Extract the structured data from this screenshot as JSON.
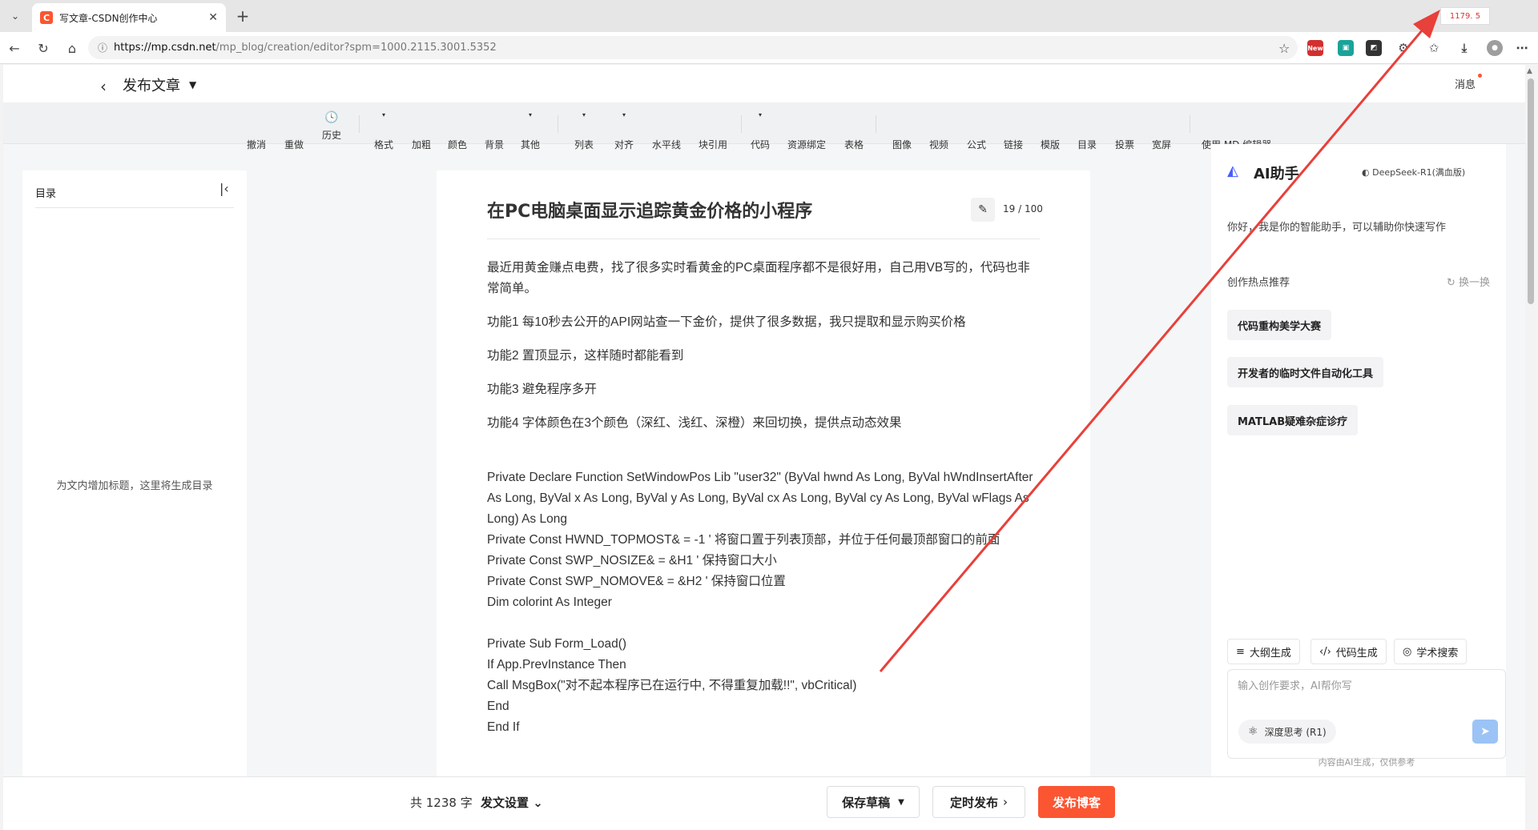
{
  "browser": {
    "tab_title": "写文章-CSDN创作中心",
    "tab_icon_letter": "C",
    "url_host": "https://mp.csdn.net",
    "url_path": "/mp_blog/creation/editor?spm=1000.2115.3001.5352",
    "coord_readout": "1179. 5",
    "ext_new_label": "New"
  },
  "header": {
    "title": "发布文章",
    "messages": "消息"
  },
  "toolbar": {
    "items": [
      "撤消",
      "重做",
      "历史",
      "格式",
      "加粗",
      "颜色",
      "背景",
      "其他",
      "列表",
      "对齐",
      "水平线",
      "块引用",
      "代码",
      "资源绑定",
      "表格",
      "图像",
      "视频",
      "公式",
      "链接",
      "模版",
      "目录",
      "投票",
      "宽屏",
      "使用 MD 编辑器"
    ]
  },
  "toc": {
    "title": "目录",
    "empty_hint": "为文内增加标题，这里将生成目录"
  },
  "editor": {
    "title": "在PC电脑桌面显示追踪黄金价格的小程序",
    "title_count": "19 / 100",
    "paragraphs": [
      "最近用黄金赚点电费，找了很多实时看黄金的PC桌面程序都不是很好用，自己用VB写的，代码也非常简单。",
      "功能1  每10秒去公开的API网站查一下金价，提供了很多数据，我只提取和显示购买价格",
      "功能2  置顶显示，这样随时都能看到",
      "功能3  避免程序多开",
      "功能4  字体颜色在3个颜色（深红、浅红、深橙）来回切换，提供点动态效果"
    ],
    "code1": [
      "Private Declare Function SetWindowPos Lib \"user32\" (ByVal hwnd As Long, ByVal hWndInsertAfter As Long, ByVal x As Long, ByVal y As Long, ByVal cx As Long, ByVal cy As Long, ByVal wFlags As Long) As Long",
      "Private Const HWND_TOPMOST& = -1 ' 将窗口置于列表顶部，并位于任何最顶部窗口的前面",
      "Private Const SWP_NOSIZE& = &H1 ' 保持窗口大小",
      "Private Const SWP_NOMOVE& = &H2 ' 保持窗口位置",
      "Dim colorint As Integer"
    ],
    "code2": [
      "Private Sub Form_Load()",
      "If App.PrevInstance Then",
      "Call MsgBox(\"对不起本程序已在运行中, 不得重复加载!!\", vbCritical)",
      "End",
      "End If"
    ]
  },
  "ai": {
    "title": "AI助手",
    "model": "DeepSeek-R1(满血版)",
    "greeting": "你好，我是你的智能助手，可以辅助你快速写作",
    "hot_label": "创作热点推荐",
    "refresh_label": "换一换",
    "topics": [
      "代码重构美学大赛",
      "开发者的临时文件自动化工具",
      "MATLAB疑难杂症诊疗"
    ],
    "tools": [
      "大纲生成",
      "代码生成",
      "学术搜索"
    ],
    "input_placeholder": "输入创作要求，AI帮你写",
    "deep_think": "深度思考 (R1)",
    "note": "内容由AI生成，仅供参考"
  },
  "footer": {
    "word_count": "共 1238 字",
    "publish_settings": "发文设置",
    "save_draft": "保存草稿",
    "scheduled": "定时发布",
    "publish": "发布博客"
  },
  "colors": {
    "brand": "#fc5531",
    "annotation": "#e8403a",
    "ai_accent": "#4a5cff"
  }
}
